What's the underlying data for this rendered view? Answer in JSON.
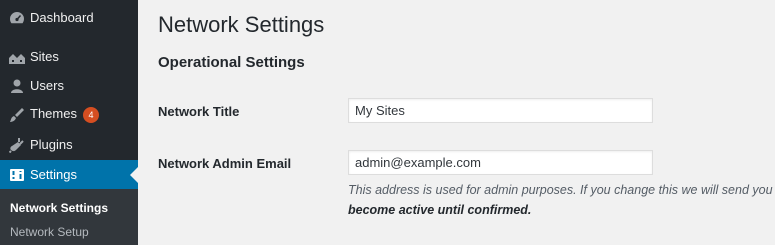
{
  "sidebar": {
    "items": [
      {
        "label": "Dashboard",
        "icon": "dashboard-icon"
      },
      {
        "label": "Sites",
        "icon": "sites-icon"
      },
      {
        "label": "Users",
        "icon": "users-icon"
      },
      {
        "label": "Themes",
        "icon": "themes-icon",
        "badge": "4"
      },
      {
        "label": "Plugins",
        "icon": "plugins-icon"
      },
      {
        "label": "Settings",
        "icon": "settings-icon",
        "current": true
      }
    ],
    "submenu": [
      {
        "label": "Network Settings",
        "current": true
      },
      {
        "label": "Network Setup"
      }
    ]
  },
  "main": {
    "page_title": "Network Settings",
    "section_title": "Operational Settings",
    "fields": {
      "network_title": {
        "label": "Network Title",
        "value": "My Sites"
      },
      "admin_email": {
        "label": "Network Admin Email",
        "value": "admin@example.com"
      }
    },
    "email_description_line1": "This address is used for admin purposes. If you change this we will send you an em",
    "email_description_line2": "become active until confirmed."
  },
  "colors": {
    "sidebar_bg": "#23282d",
    "submenu_bg": "#32373c",
    "accent": "#0073aa",
    "badge": "#d54e21",
    "page_bg": "#f1f1f1"
  }
}
